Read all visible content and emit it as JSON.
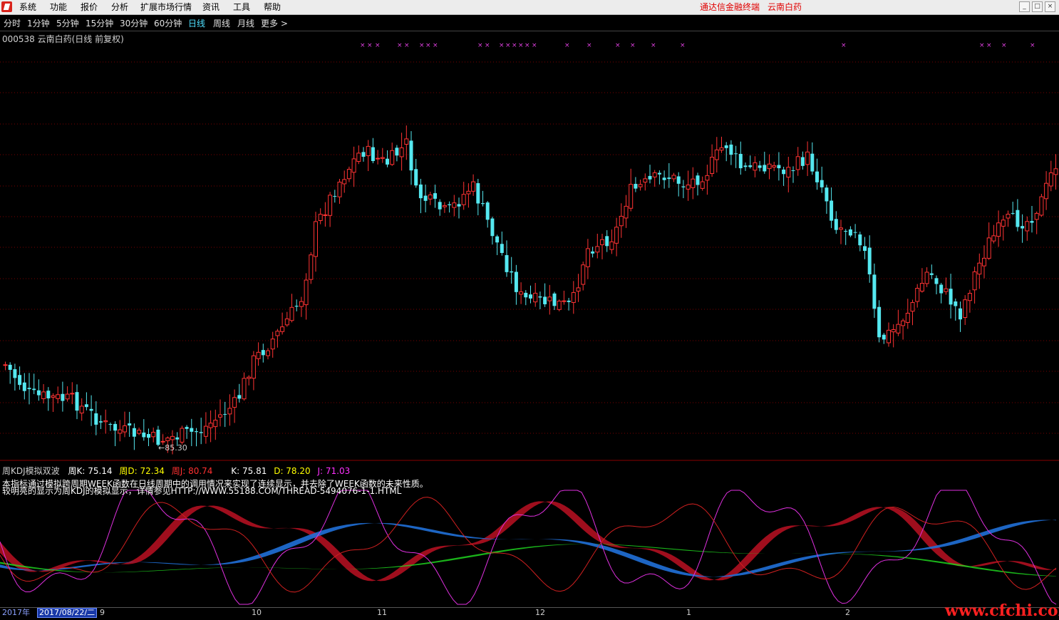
{
  "menu": {
    "items": [
      "系统",
      "功能",
      "报价",
      "分析",
      "扩展市场行情",
      "资讯",
      "工具",
      "帮助"
    ],
    "right_title": "通达信金融终端",
    "stock_name": "云南白药"
  },
  "periods": [
    "分时",
    "1分钟",
    "5分钟",
    "15分钟",
    "30分钟",
    "60分钟",
    "日线",
    "周线",
    "月线",
    "更多 >"
  ],
  "active_period": "日线",
  "chart_title": "000538 云南白药(日线 前复权)",
  "low_label": "85.30",
  "indicator": {
    "name": "周KDJ模拟双波",
    "values": [
      "周K: 75.14",
      "周D: 72.34",
      "周J: 80.74",
      "K: 75.81",
      "D: 78.20",
      "J: 71.03"
    ],
    "note1": "本指标通过模拟跨周期WEEK函数在日线周期中的调用情况来实现了连续显示，并去除了WEEK函数的未来性质。",
    "note2": "较明亮的显示为周KDJ的模拟显示，详情参见HTTP://WWW.55188.COM/THREAD-5494076-1-1.HTML"
  },
  "axis": {
    "year": "2017年",
    "date": "2017/08/22/二",
    "months": [
      "9",
      "10",
      "11",
      "12",
      "1",
      "2"
    ]
  },
  "watermark": "www.cfchi.com",
  "colors": {
    "up": "#ff3333",
    "down": "#55e8f0",
    "up_fill": "#000000",
    "marker": "#e040e0",
    "grid": "#7a0000",
    "k": "#ffffff",
    "d": "#ffff00",
    "j": "#ff00ff"
  }
}
